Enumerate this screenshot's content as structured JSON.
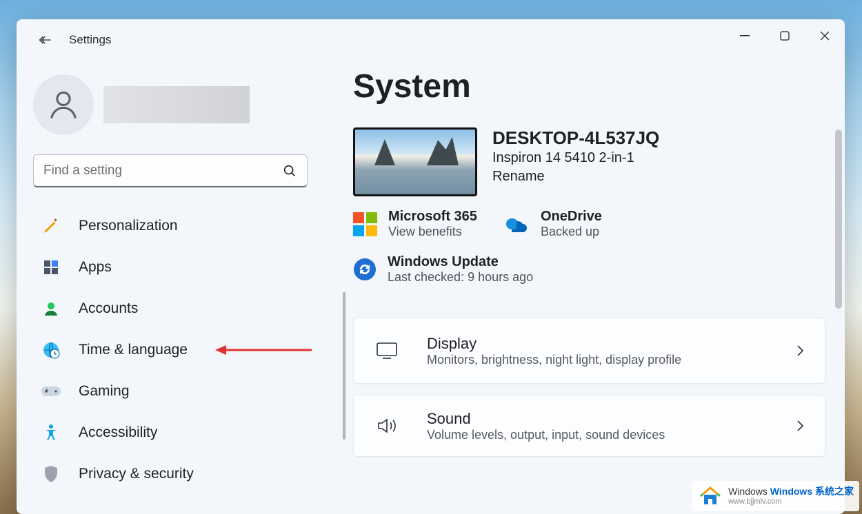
{
  "app": {
    "title": "Settings"
  },
  "search": {
    "placeholder": "Find a setting"
  },
  "sidebar": {
    "items": [
      {
        "label": "Personalization"
      },
      {
        "label": "Apps"
      },
      {
        "label": "Accounts"
      },
      {
        "label": "Time & language"
      },
      {
        "label": "Gaming"
      },
      {
        "label": "Accessibility"
      },
      {
        "label": "Privacy & security"
      }
    ]
  },
  "page": {
    "title": "System"
  },
  "device": {
    "name": "DESKTOP-4L537JQ",
    "model": "Inspiron 14 5410 2-in-1",
    "rename": "Rename"
  },
  "status": {
    "ms365": {
      "title": "Microsoft 365",
      "sub": "View benefits"
    },
    "onedrive": {
      "title": "OneDrive",
      "sub": "Backed up"
    },
    "update": {
      "title": "Windows Update",
      "sub": "Last checked: 9 hours ago"
    }
  },
  "cards": {
    "display": {
      "title": "Display",
      "sub": "Monitors, brightness, night light, display profile"
    },
    "sound": {
      "title": "Sound",
      "sub": "Volume levels, output, input, sound devices"
    }
  },
  "watermark": {
    "brand_cn": "Windows 系统之家",
    "url": "www.bjjmlv.com"
  }
}
